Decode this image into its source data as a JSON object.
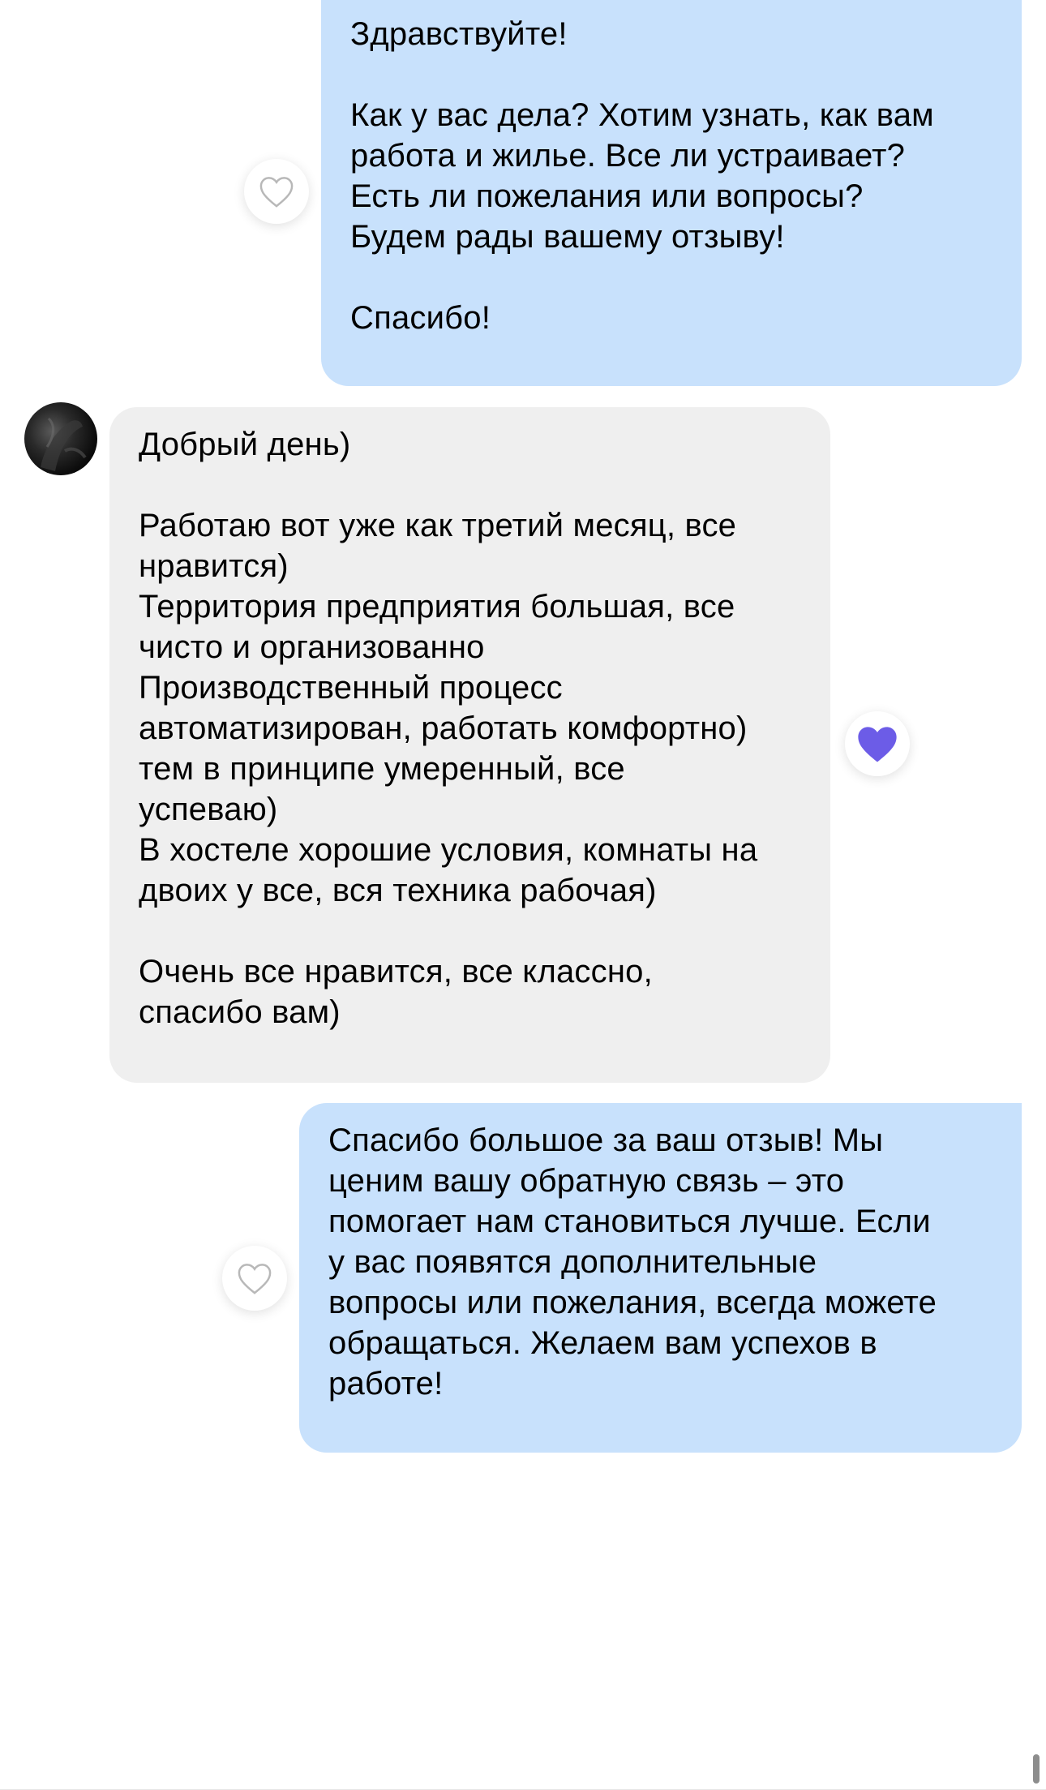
{
  "conversation": {
    "messages": [
      {
        "direction": "outgoing",
        "lines": [
          "Здравствуйте!",
          "",
          "Как у вас дела? Хотим узнать, как вам",
          "работа и жилье. Все ли устраивает?",
          "Есть ли пожелания или вопросы?",
          "Будем рады вашему отзыву!",
          "",
          "Спасибо!"
        ],
        "reaction": "heart-outline-icon",
        "liked": false
      },
      {
        "direction": "incoming",
        "lines": [
          "Добрый день)",
          "",
          "Работаю вот уже как третий месяц, все",
          "нравится)",
          "Территория предприятия большая, все",
          "чисто и организованно",
          "Производственный процесс",
          "автоматизирован, работать комфортно)",
          "тем в принципе умеренный, все",
          "успеваю)",
          "В хостеле хорошие условия, комнаты на",
          "двоих у все, вся техника рабочая)",
          "",
          "Очень все нравится, все классно,",
          "спасибо вам)"
        ],
        "reaction": "heart-filled-icon",
        "liked": true
      },
      {
        "direction": "outgoing",
        "lines": [
          "Спасибо большое за ваш отзыв! Мы",
          "ценим вашу обратную связь – это",
          "помогает нам становиться лучше. Если",
          "у вас появятся дополнительные",
          "вопросы или пожелания, всегда можете",
          "обращаться. Желаем вам успехов в",
          "работе!"
        ],
        "reaction": "heart-outline-icon",
        "liked": false
      }
    ]
  },
  "colors": {
    "outgoing_bubble": "#c8e1fc",
    "incoming_bubble": "#efefef",
    "reaction_liked": "#6c5ce7",
    "reaction_outline": "#b8b8b8",
    "text": "#000000"
  },
  "sender": {
    "avatar": "avatar-photo-icon"
  }
}
